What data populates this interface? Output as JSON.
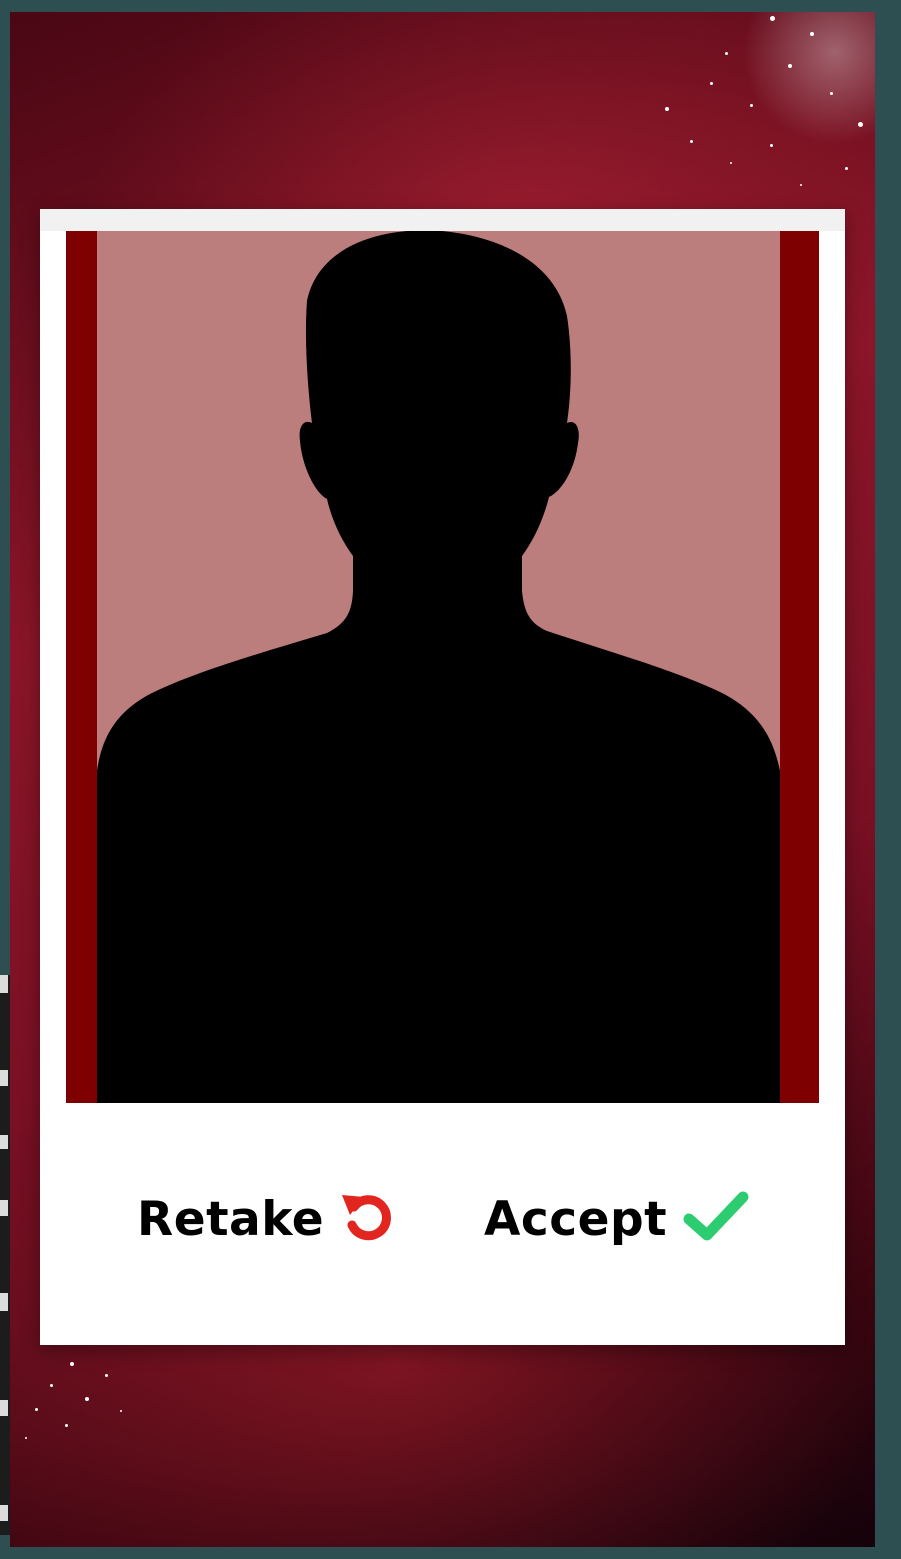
{
  "actions": {
    "retake_label": "Retake",
    "accept_label": "Accept"
  },
  "icons": {
    "retake": "undo-arrow-icon",
    "accept": "check-icon"
  },
  "colors": {
    "background": "#8a1528",
    "photo_background": "#bc7d7d",
    "photo_border": "#7f0000",
    "retake_icon": "#e2251f",
    "accept_icon": "#2ecc71"
  }
}
